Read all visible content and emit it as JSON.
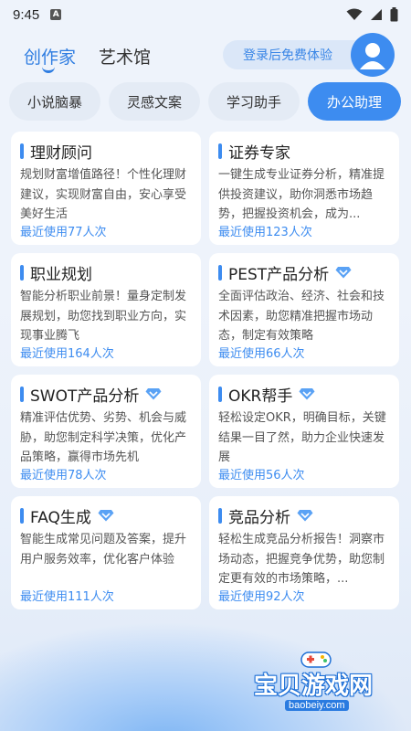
{
  "status": {
    "time": "9:45",
    "a_icon": "A"
  },
  "top_tabs": [
    {
      "label": "创作家",
      "active": true
    },
    {
      "label": "艺术馆",
      "active": false
    }
  ],
  "login_pill": "登录后免费体验",
  "chips": [
    {
      "label": "小说脑暴",
      "active": false
    },
    {
      "label": "灵感文案",
      "active": false
    },
    {
      "label": "学习助手",
      "active": false
    },
    {
      "label": "办公助理",
      "active": true
    }
  ],
  "cards": [
    {
      "title": "理财顾问",
      "vip": false,
      "desc": "规划财富增值路径！个性化理财建议，实现财富自由，安心享受美好生活",
      "usage": "最近使用77人次"
    },
    {
      "title": "证券专家",
      "vip": false,
      "desc": "一键生成专业证券分析，精准提供投资建议，助你洞悉市场趋势，把握投资机会，成为...",
      "usage": "最近使用123人次"
    },
    {
      "title": "职业规划",
      "vip": false,
      "desc": "智能分析职业前景！量身定制发展规划，助您找到职业方向，实现事业腾飞",
      "usage": "最近使用164人次"
    },
    {
      "title": "PEST产品分析",
      "vip": true,
      "desc": "全面评估政治、经济、社会和技术因素，助您精准把握市场动态，制定有效策略",
      "usage": "最近使用66人次"
    },
    {
      "title": "SWOT产品分析",
      "vip": true,
      "desc": "精准评估优势、劣势、机会与威胁，助您制定科学决策，优化产品策略，赢得市场先机",
      "usage": "最近使用78人次"
    },
    {
      "title": "OKR帮手",
      "vip": true,
      "desc": "轻松设定OKR，明确目标，关键结果一目了然，助力企业快速发展",
      "usage": "最近使用56人次"
    },
    {
      "title": "FAQ生成",
      "vip": true,
      "desc": "智能生成常见问题及答案，提升用户服务效率，优化客户体验",
      "usage": "最近使用111人次"
    },
    {
      "title": "竞品分析",
      "vip": true,
      "desc": "轻松生成竞品分析报告！洞察市场动态，把握竞争优势，助您制定更有效的市场策略，...",
      "usage": "最近使用92人次"
    }
  ],
  "watermark": {
    "text": "宝贝游戏网",
    "url": "baobeiy.com"
  },
  "colors": {
    "accent": "#3d8cf0",
    "background": "#eef3fb",
    "card": "#ffffff"
  }
}
